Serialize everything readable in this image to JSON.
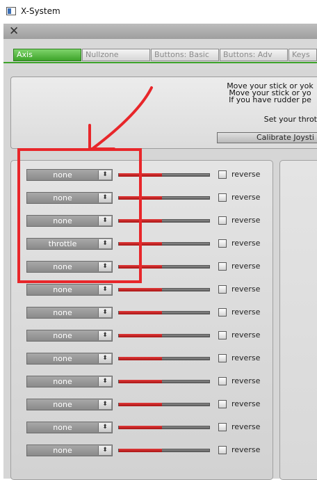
{
  "window": {
    "title": "X-System",
    "close_glyph": "✕"
  },
  "tabs": [
    {
      "label": "Axis",
      "active": true
    },
    {
      "label": "Nullzone",
      "active": false
    },
    {
      "label": "Buttons: Basic",
      "active": false
    },
    {
      "label": "Buttons: Adv",
      "active": false
    },
    {
      "label": "Keys",
      "active": false
    }
  ],
  "instructions": {
    "line1": "Move your stick or yok",
    "line2": "Move your stick or yo",
    "line3": "If you have rudder pe",
    "throttle_hint": "Set your throt",
    "calibrate_label": "Calibrate Joysti"
  },
  "axes": [
    {
      "assignment": "none",
      "level": 0.48,
      "reverse_label": "reverse",
      "reverse": false
    },
    {
      "assignment": "none",
      "level": 0.48,
      "reverse_label": "reverse",
      "reverse": false
    },
    {
      "assignment": "none",
      "level": 0.48,
      "reverse_label": "reverse",
      "reverse": false
    },
    {
      "assignment": "throttle",
      "level": 0.48,
      "reverse_label": "reverse",
      "reverse": false
    },
    {
      "assignment": "none",
      "level": 0.48,
      "reverse_label": "reverse",
      "reverse": false
    },
    {
      "assignment": "none",
      "level": 0.48,
      "reverse_label": "reverse",
      "reverse": false
    },
    {
      "assignment": "none",
      "level": 0.48,
      "reverse_label": "reverse",
      "reverse": false
    },
    {
      "assignment": "none",
      "level": 0.48,
      "reverse_label": "reverse",
      "reverse": false
    },
    {
      "assignment": "none",
      "level": 0.48,
      "reverse_label": "reverse",
      "reverse": false
    },
    {
      "assignment": "none",
      "level": 0.48,
      "reverse_label": "reverse",
      "reverse": false
    },
    {
      "assignment": "none",
      "level": 0.48,
      "reverse_label": "reverse",
      "reverse": false
    },
    {
      "assignment": "none",
      "level": 0.48,
      "reverse_label": "reverse",
      "reverse": false
    },
    {
      "assignment": "none",
      "level": 0.48,
      "reverse_label": "reverse",
      "reverse": false
    }
  ],
  "colors": {
    "active_tab": "#3da32a",
    "bar_fill": "#c41e1e",
    "annotation": "#e8262a"
  },
  "icons": {
    "app": "window-app-icon",
    "close": "close-icon",
    "dropdown": "updown-arrow-icon"
  }
}
